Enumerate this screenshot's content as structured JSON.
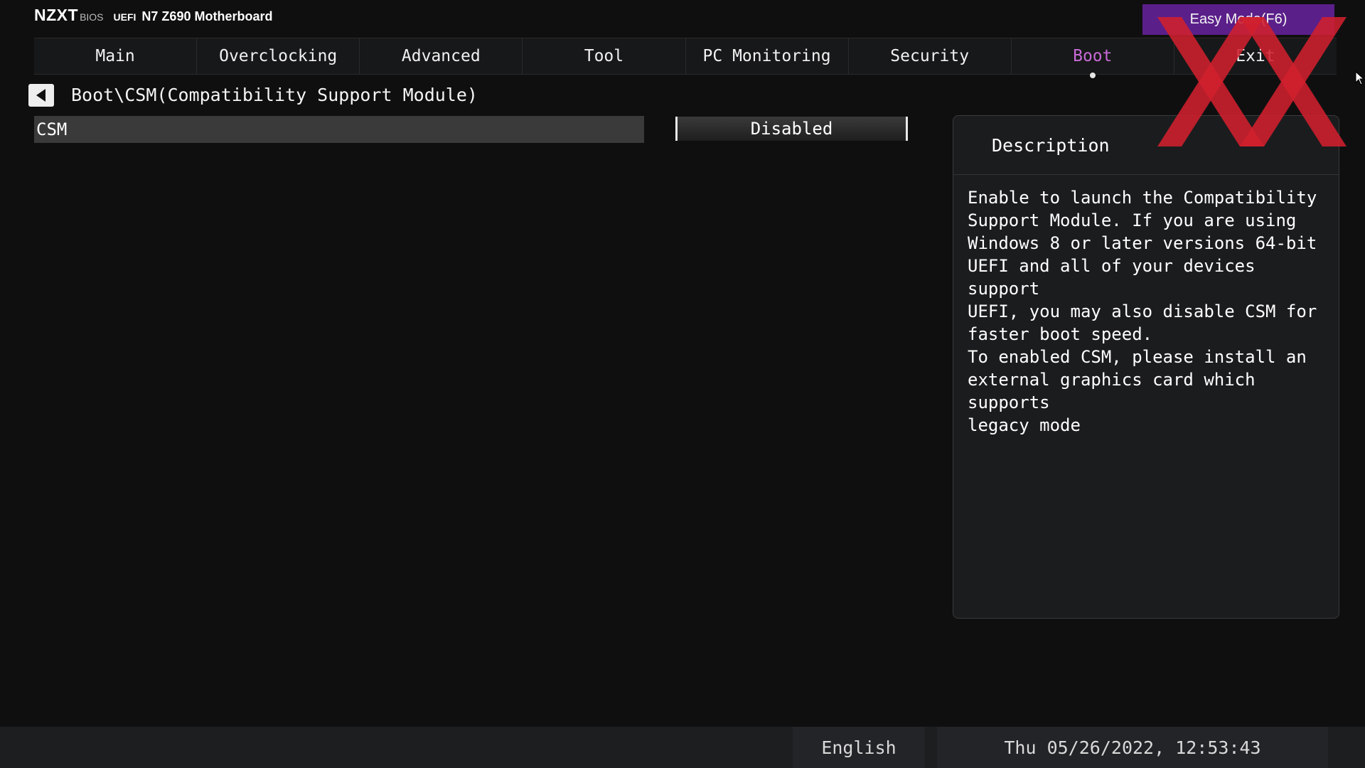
{
  "header": {
    "brand": "NZXT",
    "brand_sub": "BIOS",
    "uefi": "UEFI",
    "board": "N7 Z690 Motherboard",
    "easy_mode_label": "Easy Mode(F6)"
  },
  "tabs": [
    {
      "label": "Main"
    },
    {
      "label": "Overclocking"
    },
    {
      "label": "Advanced"
    },
    {
      "label": "Tool"
    },
    {
      "label": "PC Monitoring"
    },
    {
      "label": "Security"
    },
    {
      "label": "Boot"
    },
    {
      "label": "Exit"
    }
  ],
  "active_tab": "Boot",
  "breadcrumb": "Boot\\CSM(Compatibility Support Module)",
  "setting": {
    "label": "CSM",
    "value": "Disabled"
  },
  "description": {
    "title": "Description",
    "text": "Enable to launch the Compatibility\nSupport Module. If you are using\nWindows 8 or later versions 64-bit\nUEFI and all of your devices support\nUEFI, you may also disable CSM for\nfaster boot speed.\nTo enabled CSM, please install an\nexternal graphics card which supports\nlegacy mode"
  },
  "footer": {
    "language": "English",
    "datetime": "Thu 05/26/2022, 12:53:43"
  },
  "colors": {
    "accent_purple": "#5b1f8a",
    "active_tab": "#c86bd6",
    "watermark_red": "#d0202e"
  },
  "icons": {
    "back": "back-arrow-icon",
    "watermark": "watermark-xx-icon",
    "cursor": "mouse-cursor-icon"
  }
}
